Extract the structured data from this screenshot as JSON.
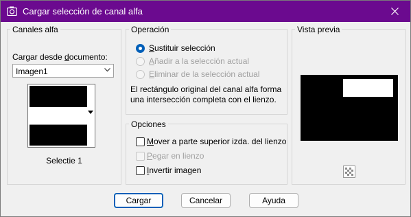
{
  "window": {
    "title": "Cargar selección de canal alfa",
    "accent_color": "#6b0a8f"
  },
  "canales": {
    "legend": "Canales alfa",
    "cargar_label_pre": "Cargar desde ",
    "cargar_label_mnemonic": "d",
    "cargar_label_post": "ocumento:",
    "document_value": "Imagen1",
    "channel_name": "Selectie 1"
  },
  "operacion": {
    "legend": "Operación",
    "options": [
      {
        "mnemonic": "S",
        "rest": "ustituir selección",
        "checked": true,
        "enabled": true
      },
      {
        "mnemonic": "A",
        "rest": "ñadir a la selección actual",
        "checked": false,
        "enabled": false
      },
      {
        "mnemonic": "E",
        "rest": "liminar de la selección actual",
        "checked": false,
        "enabled": false
      }
    ],
    "description": "El rectángulo original del canal alfa forma una intersección completa con el lienzo."
  },
  "opciones": {
    "legend": "Opciones",
    "items": [
      {
        "mnemonic": "M",
        "rest": "over a parte superior izda. del lienzo",
        "checked": false,
        "enabled": true
      },
      {
        "mnemonic": "P",
        "rest": "egar en lienzo",
        "checked": false,
        "enabled": false
      },
      {
        "mnemonic": "I",
        "rest": "nvertir imagen",
        "checked": false,
        "enabled": true
      }
    ]
  },
  "vista": {
    "legend": "Vista previa"
  },
  "buttons": {
    "cargar": "Cargar",
    "cancelar": "Cancelar",
    "ayuda": "Ayuda"
  }
}
